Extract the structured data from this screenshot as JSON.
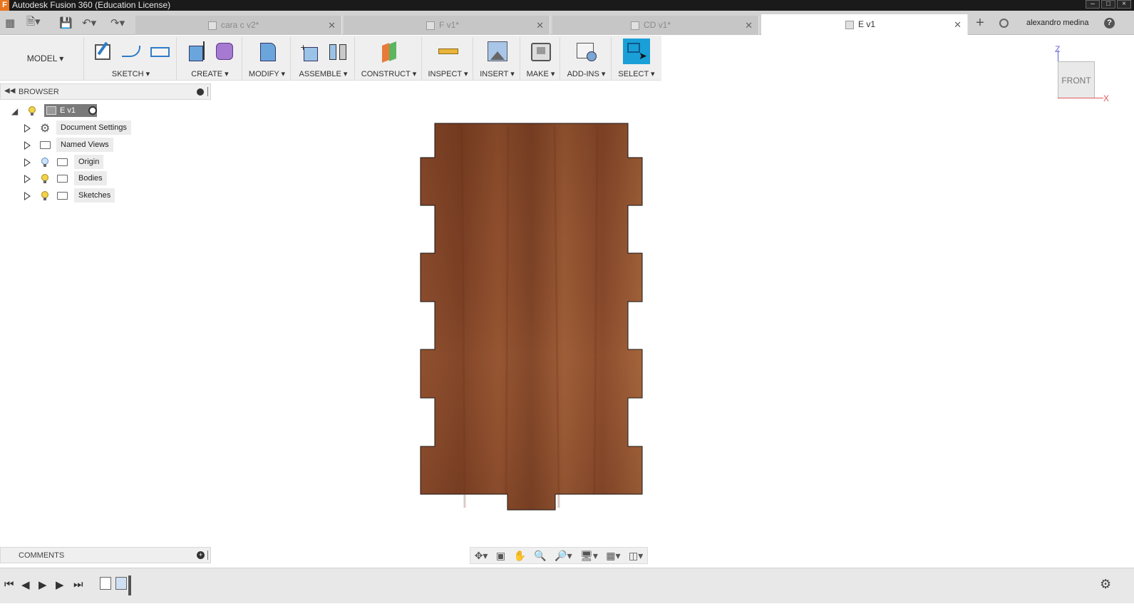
{
  "window": {
    "app_icon": "F",
    "title": "Autodesk Fusion 360 (Education License)",
    "controls": [
      "minimize-icon",
      "maximize-icon",
      "close-icon"
    ]
  },
  "quick_access": {
    "icons": [
      "grid-icon",
      "file-icon",
      "save-icon",
      "undo-icon",
      "redo-icon"
    ]
  },
  "tabs": [
    {
      "label": "cara c v2*",
      "active": false
    },
    {
      "label": "F v1*",
      "active": false
    },
    {
      "label": "CD v1*",
      "active": false
    },
    {
      "label": "E v1",
      "active": true
    }
  ],
  "user": {
    "name": "alexandro medina"
  },
  "toolbar": {
    "workspace": "MODEL ▾",
    "groups": [
      {
        "label": "SKETCH ▾"
      },
      {
        "label": "CREATE ▾"
      },
      {
        "label": "MODIFY ▾"
      },
      {
        "label": "ASSEMBLE ▾"
      },
      {
        "label": "CONSTRUCT ▾"
      },
      {
        "label": "INSPECT ▾"
      },
      {
        "label": "INSERT ▾"
      },
      {
        "label": "MAKE ▾"
      },
      {
        "label": "ADD-INS ▾"
      },
      {
        "label": "SELECT ▾"
      }
    ]
  },
  "browser": {
    "title": "BROWSER",
    "root": "E v1",
    "items": [
      {
        "label": "Document Settings"
      },
      {
        "label": "Named Views"
      },
      {
        "label": "Origin"
      },
      {
        "label": "Bodies"
      },
      {
        "label": "Sketches"
      }
    ]
  },
  "comments": {
    "title": "COMMENTS"
  },
  "viewcube": {
    "face": "FRONT",
    "axis_z": "Z",
    "axis_x": "X"
  },
  "colors": {
    "wood": "#8b4a2b",
    "select_active": "#1a9fd8",
    "titlebar": "#1a1a1a"
  }
}
